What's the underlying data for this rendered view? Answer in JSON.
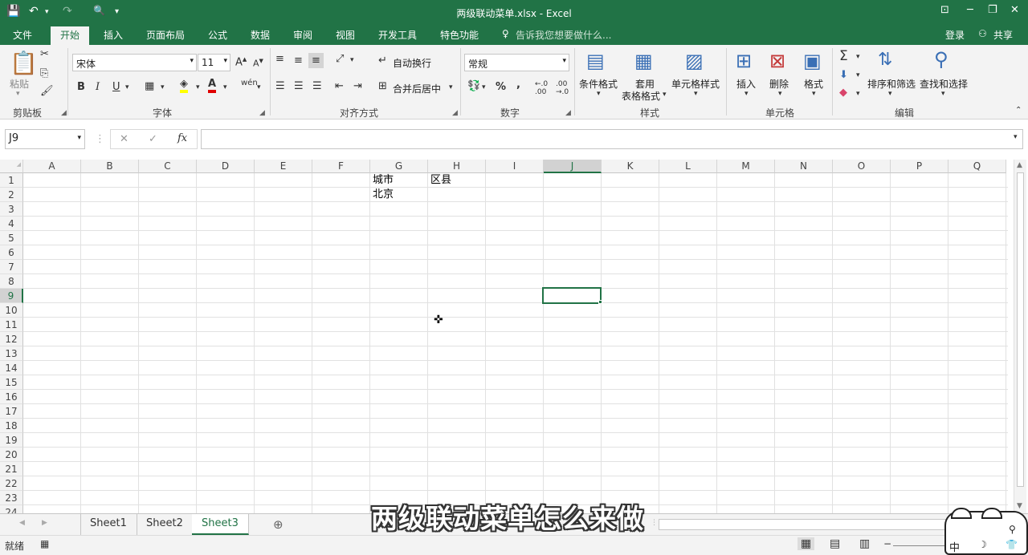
{
  "window": {
    "title": "两级联动菜单.xlsx - Excel",
    "qa_save": "💾",
    "qa_undo": "↶",
    "qa_redo": "↷",
    "qa_preview": "🔍"
  },
  "tabs": [
    "文件",
    "开始",
    "插入",
    "页面布局",
    "公式",
    "数据",
    "审阅",
    "视图",
    "开发工具",
    "特色功能"
  ],
  "tell_me": "告诉我您想要做什么...",
  "account": {
    "login": "登录",
    "share": "共享"
  },
  "ribbon": {
    "clipboard": {
      "label": "剪贴板",
      "paste": "粘贴"
    },
    "font": {
      "label": "字体",
      "font_name": "宋体",
      "font_size": "11",
      "bold": "B",
      "italic": "I",
      "underline": "U"
    },
    "alignment": {
      "label": "对齐方式",
      "wrap_text": "自动换行",
      "merge_center": "合并后居中"
    },
    "number": {
      "label": "数字",
      "format": "常规",
      "percent": "%",
      "comma": ","
    },
    "styles": {
      "label": "样式",
      "conditional": "条件格式",
      "table_format_1": "套用",
      "table_format_2": "表格格式",
      "cell_styles": "单元格样式"
    },
    "cells": {
      "label": "单元格",
      "insert": "插入",
      "delete": "删除",
      "format": "格式"
    },
    "editing": {
      "label": "编辑",
      "sort_filter": "排序和筛选",
      "find_select": "查找和选择"
    }
  },
  "formula_bar": {
    "name_box": "J9",
    "fx": "fx",
    "cancel": "✕",
    "enter": "✓",
    "formula": ""
  },
  "columns": [
    "A",
    "B",
    "C",
    "D",
    "E",
    "F",
    "G",
    "H",
    "I",
    "J",
    "K",
    "L",
    "M",
    "N",
    "O",
    "P",
    "Q"
  ],
  "rows": [
    "1",
    "2",
    "3",
    "4",
    "5",
    "6",
    "7",
    "8",
    "9",
    "10",
    "11",
    "12",
    "13",
    "14",
    "15",
    "16",
    "17",
    "18",
    "19",
    "20",
    "21",
    "22",
    "23",
    "24"
  ],
  "cells": {
    "G1": "城市",
    "H1": "区县",
    "G2": "北京"
  },
  "sheets": [
    "Sheet1",
    "Sheet2",
    "Sheet3"
  ],
  "active_sheet": "Sheet3",
  "status": {
    "ready": "就绪"
  },
  "subtitle": "两级联动菜单怎么来做",
  "ime": {
    "mode": "中"
  },
  "colors": {
    "excel_green": "#217346"
  }
}
